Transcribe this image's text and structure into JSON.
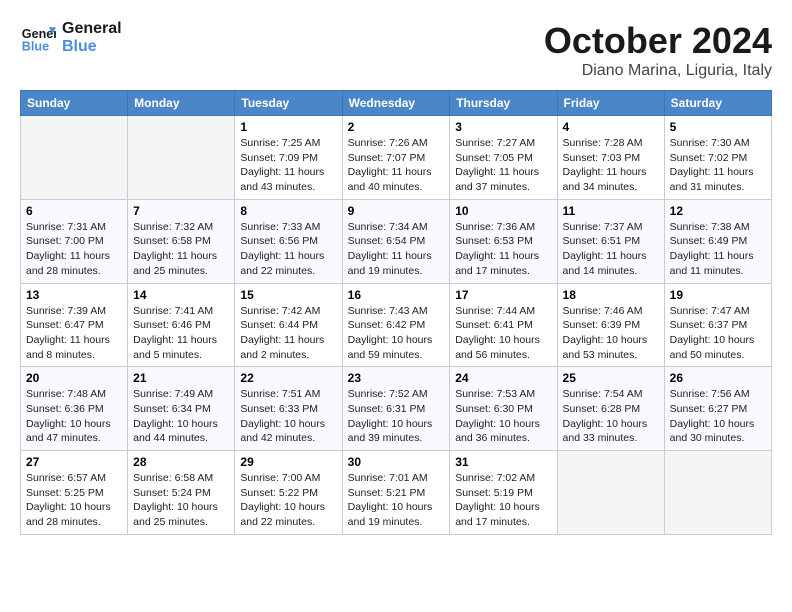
{
  "header": {
    "logo_line1": "General",
    "logo_line2": "Blue",
    "month": "October 2024",
    "location": "Diano Marina, Liguria, Italy"
  },
  "days_of_week": [
    "Sunday",
    "Monday",
    "Tuesday",
    "Wednesday",
    "Thursday",
    "Friday",
    "Saturday"
  ],
  "weeks": [
    [
      {
        "day": "",
        "empty": true
      },
      {
        "day": "",
        "empty": true
      },
      {
        "day": "1",
        "sunrise": "7:25 AM",
        "sunset": "7:09 PM",
        "daylight": "11 hours and 43 minutes."
      },
      {
        "day": "2",
        "sunrise": "7:26 AM",
        "sunset": "7:07 PM",
        "daylight": "11 hours and 40 minutes."
      },
      {
        "day": "3",
        "sunrise": "7:27 AM",
        "sunset": "7:05 PM",
        "daylight": "11 hours and 37 minutes."
      },
      {
        "day": "4",
        "sunrise": "7:28 AM",
        "sunset": "7:03 PM",
        "daylight": "11 hours and 34 minutes."
      },
      {
        "day": "5",
        "sunrise": "7:30 AM",
        "sunset": "7:02 PM",
        "daylight": "11 hours and 31 minutes."
      }
    ],
    [
      {
        "day": "6",
        "sunrise": "7:31 AM",
        "sunset": "7:00 PM",
        "daylight": "11 hours and 28 minutes."
      },
      {
        "day": "7",
        "sunrise": "7:32 AM",
        "sunset": "6:58 PM",
        "daylight": "11 hours and 25 minutes."
      },
      {
        "day": "8",
        "sunrise": "7:33 AM",
        "sunset": "6:56 PM",
        "daylight": "11 hours and 22 minutes."
      },
      {
        "day": "9",
        "sunrise": "7:34 AM",
        "sunset": "6:54 PM",
        "daylight": "11 hours and 19 minutes."
      },
      {
        "day": "10",
        "sunrise": "7:36 AM",
        "sunset": "6:53 PM",
        "daylight": "11 hours and 17 minutes."
      },
      {
        "day": "11",
        "sunrise": "7:37 AM",
        "sunset": "6:51 PM",
        "daylight": "11 hours and 14 minutes."
      },
      {
        "day": "12",
        "sunrise": "7:38 AM",
        "sunset": "6:49 PM",
        "daylight": "11 hours and 11 minutes."
      }
    ],
    [
      {
        "day": "13",
        "sunrise": "7:39 AM",
        "sunset": "6:47 PM",
        "daylight": "11 hours and 8 minutes."
      },
      {
        "day": "14",
        "sunrise": "7:41 AM",
        "sunset": "6:46 PM",
        "daylight": "11 hours and 5 minutes."
      },
      {
        "day": "15",
        "sunrise": "7:42 AM",
        "sunset": "6:44 PM",
        "daylight": "11 hours and 2 minutes."
      },
      {
        "day": "16",
        "sunrise": "7:43 AM",
        "sunset": "6:42 PM",
        "daylight": "10 hours and 59 minutes."
      },
      {
        "day": "17",
        "sunrise": "7:44 AM",
        "sunset": "6:41 PM",
        "daylight": "10 hours and 56 minutes."
      },
      {
        "day": "18",
        "sunrise": "7:46 AM",
        "sunset": "6:39 PM",
        "daylight": "10 hours and 53 minutes."
      },
      {
        "day": "19",
        "sunrise": "7:47 AM",
        "sunset": "6:37 PM",
        "daylight": "10 hours and 50 minutes."
      }
    ],
    [
      {
        "day": "20",
        "sunrise": "7:48 AM",
        "sunset": "6:36 PM",
        "daylight": "10 hours and 47 minutes."
      },
      {
        "day": "21",
        "sunrise": "7:49 AM",
        "sunset": "6:34 PM",
        "daylight": "10 hours and 44 minutes."
      },
      {
        "day": "22",
        "sunrise": "7:51 AM",
        "sunset": "6:33 PM",
        "daylight": "10 hours and 42 minutes."
      },
      {
        "day": "23",
        "sunrise": "7:52 AM",
        "sunset": "6:31 PM",
        "daylight": "10 hours and 39 minutes."
      },
      {
        "day": "24",
        "sunrise": "7:53 AM",
        "sunset": "6:30 PM",
        "daylight": "10 hours and 36 minutes."
      },
      {
        "day": "25",
        "sunrise": "7:54 AM",
        "sunset": "6:28 PM",
        "daylight": "10 hours and 33 minutes."
      },
      {
        "day": "26",
        "sunrise": "7:56 AM",
        "sunset": "6:27 PM",
        "daylight": "10 hours and 30 minutes."
      }
    ],
    [
      {
        "day": "27",
        "sunrise": "6:57 AM",
        "sunset": "5:25 PM",
        "daylight": "10 hours and 28 minutes."
      },
      {
        "day": "28",
        "sunrise": "6:58 AM",
        "sunset": "5:24 PM",
        "daylight": "10 hours and 25 minutes."
      },
      {
        "day": "29",
        "sunrise": "7:00 AM",
        "sunset": "5:22 PM",
        "daylight": "10 hours and 22 minutes."
      },
      {
        "day": "30",
        "sunrise": "7:01 AM",
        "sunset": "5:21 PM",
        "daylight": "10 hours and 19 minutes."
      },
      {
        "day": "31",
        "sunrise": "7:02 AM",
        "sunset": "5:19 PM",
        "daylight": "10 hours and 17 minutes."
      },
      {
        "day": "",
        "empty": true
      },
      {
        "day": "",
        "empty": true
      }
    ]
  ]
}
